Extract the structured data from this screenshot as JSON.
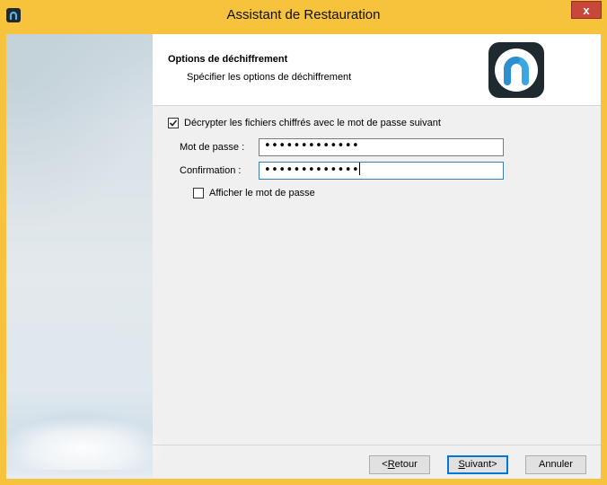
{
  "window": {
    "title": "Assistant de Restauration",
    "close_label": "x",
    "frame_color": "#f7c33d",
    "close_color": "#c7473a"
  },
  "header": {
    "title": "Options de déchiffrement",
    "subtitle": "Spécifier les options de déchiffrement",
    "logo_icon": "app-logo-icon"
  },
  "decrypt": {
    "checked": true,
    "label": "Décrypter les fichiers chiffrés avec le mot de passe suivant"
  },
  "password": {
    "label": "Mot de passe :",
    "value": "•••••••••••••"
  },
  "confirmation": {
    "label": "Confirmation :",
    "value": "•••••••••••••"
  },
  "show_password": {
    "checked": false,
    "label": "Afficher le mot de passe"
  },
  "footer": {
    "back_prefix": "<",
    "back_mnemonic": "R",
    "back_rest": "etour",
    "next_mnemonic": "S",
    "next_rest": "uivant>",
    "cancel_label": "Annuler"
  }
}
